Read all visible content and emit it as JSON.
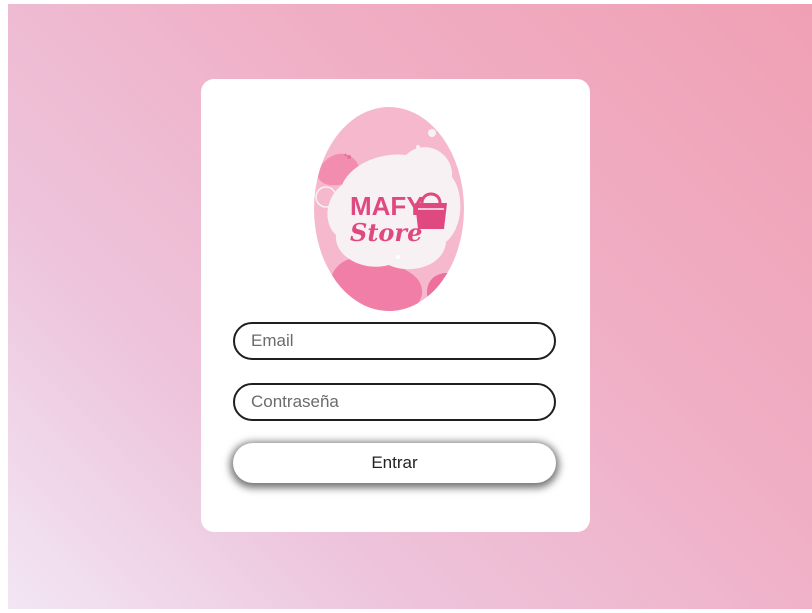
{
  "login": {
    "logo": {
      "line1": "MAFY",
      "line2": "Store"
    },
    "email": {
      "placeholder": "Email",
      "value": ""
    },
    "password": {
      "placeholder": "Contraseña",
      "value": ""
    },
    "submit_label": "Entrar"
  },
  "colors": {
    "background_start": "#f2e6f4",
    "background_end": "#f0a0b4",
    "card": "#ffffff",
    "logo_pink": "#f5b8cd",
    "logo_magenta": "#e0497f",
    "field_border": "#1f1f1f"
  },
  "icons": [
    "store-logo",
    "shopping-bag-icon"
  ]
}
